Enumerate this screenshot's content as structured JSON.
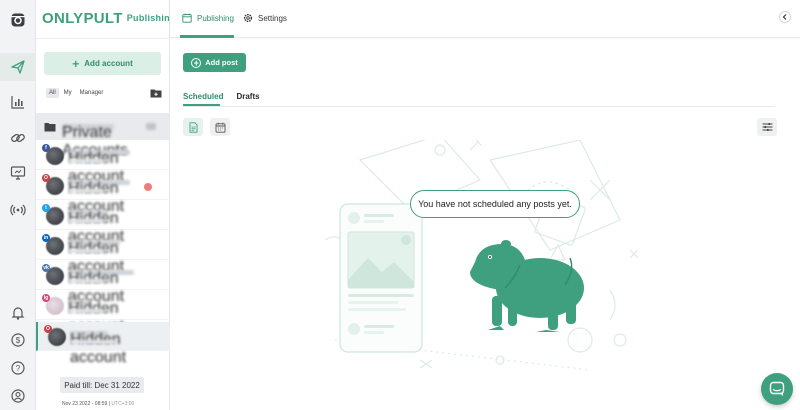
{
  "brand": {
    "name": "ONLYPULT",
    "section": "Publishing"
  },
  "accounts_panel": {
    "add_account_label": "Add account",
    "filters": [
      "All",
      "My",
      "Manager"
    ],
    "group_label": "Private Accounts",
    "items": [
      {
        "name": "Hidden account",
        "network": "facebook",
        "badge": "f",
        "badge_color": "#3b5998"
      },
      {
        "name": "Hidden account",
        "network": "onlyfans",
        "badge": "O",
        "badge_color": "#c94040",
        "alert": true
      },
      {
        "name": "Hidden account",
        "network": "twitter",
        "badge": "t",
        "badge_color": "#1da1f2"
      },
      {
        "name": "Hidden account",
        "network": "linkedin",
        "badge": "in",
        "badge_color": "#0a66c2"
      },
      {
        "name": "Hidden account",
        "network": "vk",
        "badge": "vk",
        "badge_color": "#4a76a8"
      },
      {
        "name": "Hidden account",
        "network": "instagram",
        "badge": "ig",
        "badge_color": "#d9467a"
      },
      {
        "name": "Hidden account",
        "network": "onlyfans",
        "badge": "O",
        "badge_color": "#c94040",
        "selected": true
      }
    ],
    "paid_till": "Paid till: Dec 31 2022",
    "datetime": "Nov 23 2022 - 08:59",
    "timezone": "UTC+3:00"
  },
  "header": {
    "tabs": [
      {
        "label": "Publishing",
        "icon": "calendar-icon",
        "active": true
      },
      {
        "label": "Settings",
        "icon": "gear-icon",
        "active": false
      }
    ]
  },
  "toolbar": {
    "add_post_label": "Add post"
  },
  "sub_tabs": [
    {
      "label": "Scheduled",
      "active": true
    },
    {
      "label": "Drafts",
      "active": false
    }
  ],
  "empty_state": {
    "message": "You have not scheduled any posts yet."
  },
  "colors": {
    "accent": "#3ea07f",
    "accent_light": "#dcefe6",
    "rail_bg": "#f2f3f5"
  }
}
